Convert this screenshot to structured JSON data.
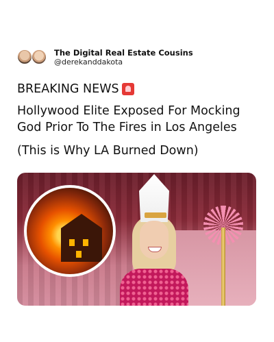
{
  "account": {
    "name": "The Digital Real Estate Cousins",
    "handle": "@derekanddakota"
  },
  "post": {
    "breaking": "BREAKING NEWS",
    "breaking_icon": "police-siren-icon",
    "headline_line1": "Hollywood Elite Exposed For Mocking",
    "headline_line2": "God Prior To The Fires in Los Angeles",
    "subline": "(This is Why LA Burned Down)"
  },
  "image": {
    "description_icons": [
      "burning-house-image",
      "celebrity-photo"
    ]
  },
  "colors": {
    "text": "#111111",
    "siren": "#e53935"
  }
}
